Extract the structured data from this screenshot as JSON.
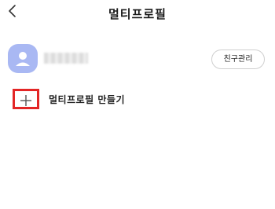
{
  "header": {
    "back_icon": "chevron-left-icon",
    "title": "멀티프로필"
  },
  "profile": {
    "avatar_icon": "person-icon",
    "avatar_color": "#a9b8f3",
    "name": "",
    "manage_friends_label": "친구관리"
  },
  "create": {
    "icon": "plus-icon",
    "highlight_color": "#e32626",
    "label": "멀티프로필 만들기"
  }
}
